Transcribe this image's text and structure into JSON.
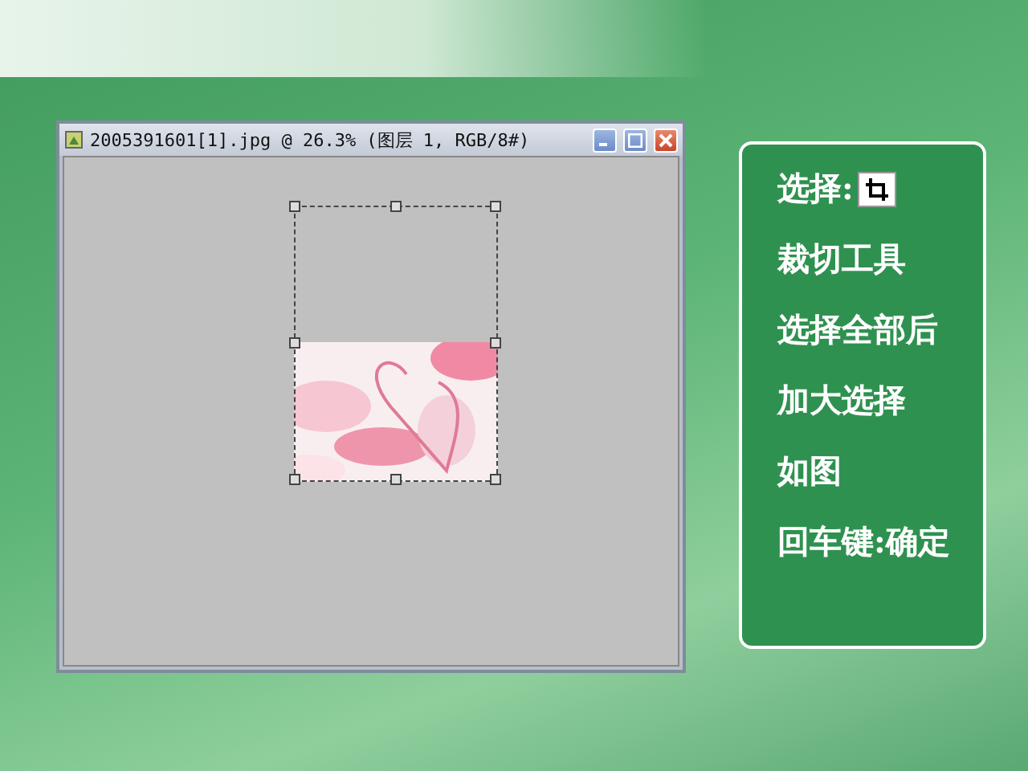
{
  "document_window": {
    "title": "2005391601[1].jpg @ 26.3% (图层 1, RGB/8#)",
    "crop_box": {
      "kind": "crop"
    }
  },
  "instructions": [
    {
      "kind": "with_tool_icon",
      "text": "选择:"
    },
    {
      "kind": "text",
      "text": "裁切工具"
    },
    {
      "kind": "text",
      "text": "选择全部后"
    },
    {
      "kind": "text",
      "text": "加大选择"
    },
    {
      "kind": "text",
      "text": "如图"
    },
    {
      "kind": "text",
      "text": "回车键:确定"
    }
  ]
}
